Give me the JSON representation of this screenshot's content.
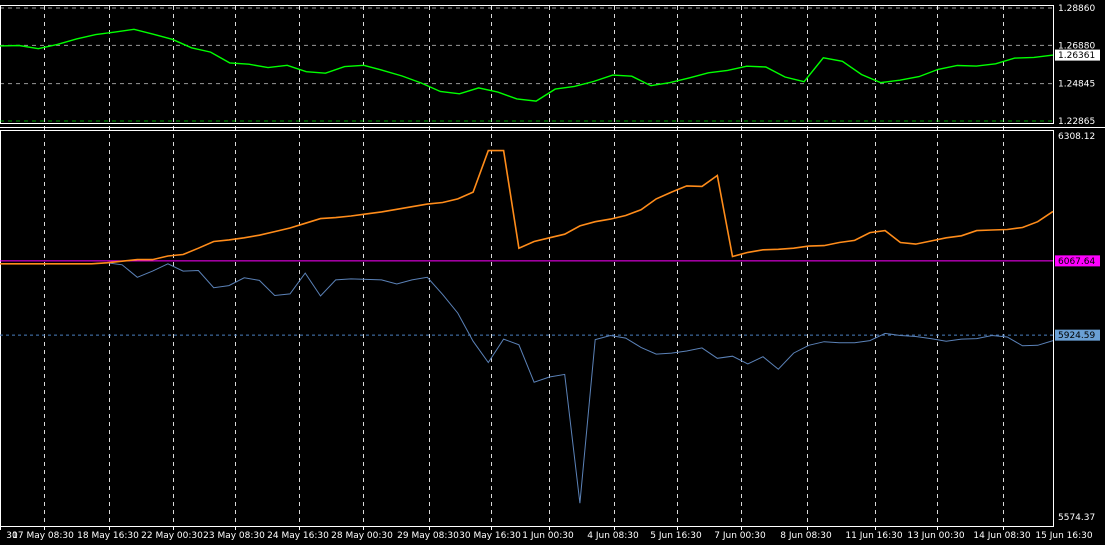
{
  "chart_data": [
    {
      "type": "line",
      "panel": "price",
      "ylim": [
        1.22865,
        1.2886
      ],
      "y_ticks": [
        "1.28860",
        "1.26880",
        "1.24845",
        "1.22865"
      ],
      "current_value_label": "1.26361",
      "colors": {
        "series": "#00ff00",
        "grid": "#ffffff",
        "label_bg": "#ffffff",
        "label_text": "#000000"
      },
      "series": [
        {
          "values": [
            1.2685,
            1.2687,
            1.267,
            1.2693,
            1.2722,
            1.2745,
            1.2758,
            1.2773,
            1.2747,
            1.272,
            1.2675,
            1.2652,
            1.2595,
            1.2588,
            1.257,
            1.2582,
            1.2548,
            1.254,
            1.2575,
            1.2582,
            1.2555,
            1.2525,
            1.2488,
            1.2443,
            1.2431,
            1.2462,
            1.244,
            1.2404,
            1.2392,
            1.2456,
            1.247,
            1.2496,
            1.253,
            1.2524,
            1.2474,
            1.249,
            1.2515,
            1.2542,
            1.2555,
            1.2577,
            1.2573,
            1.252,
            1.2495,
            1.2622,
            1.2603,
            1.2533,
            1.249,
            1.2503,
            1.2522,
            1.256,
            1.2581,
            1.2578,
            1.259,
            1.262,
            1.2624,
            1.2636
          ]
        }
      ]
    },
    {
      "type": "line",
      "panel": "balance",
      "ylim": [
        5574.37,
        6308.12
      ],
      "y_ticks": [
        "6308.12",
        "5574.37"
      ],
      "reference_lines": [
        {
          "value": 6067.64,
          "label": "6067.64",
          "style": "solid",
          "color": "#ff00ff",
          "label_bg": "#ff00ff",
          "label_text": "#000000"
        },
        {
          "value": 5924.59,
          "label": "5924.59",
          "style": "dashed",
          "color": "#4a7fbf",
          "label_bg": "#6a9fd4",
          "label_text": "#000000"
        }
      ],
      "colors": {
        "balance": "#ff8c1a",
        "equity": "#5b82b8",
        "grid": "#ffffff"
      },
      "series": [
        {
          "values": [
            6062,
            6062,
            6062,
            6062,
            6062,
            6062,
            6062,
            6064,
            6067,
            6070,
            6070,
            6077,
            6080,
            6092,
            6105,
            6108,
            6112,
            6117,
            6124,
            6131,
            6140,
            6149,
            6151,
            6154,
            6158,
            6162,
            6167,
            6172,
            6177,
            6180,
            6187,
            6200,
            6280,
            6280,
            6092,
            6105,
            6112,
            6119,
            6135,
            6143,
            6148,
            6155,
            6166,
            6187,
            6200,
            6212,
            6211,
            6232,
            6076,
            6084,
            6089,
            6090,
            6092,
            6096,
            6097,
            6103,
            6107,
            6122,
            6126,
            6103,
            6100,
            6106,
            6112,
            6116,
            6126,
            6127,
            6128,
            6132,
            6143,
            6163
          ]
        },
        {
          "values": [
            6062,
            6062,
            6062,
            6062,
            6062,
            6062,
            6062,
            6064,
            6060,
            6036,
            6048,
            6062,
            6048,
            6049,
            6016,
            6020,
            6035,
            6030,
            6001,
            6004,
            6044,
            6000,
            6031,
            6033,
            6032,
            6031,
            6023,
            6031,
            6036,
            6003,
            5967,
            5913,
            5872,
            5917,
            5906,
            5834,
            5844,
            5849,
            5601,
            5916,
            5924,
            5919,
            5901,
            5888,
            5890,
            5894,
            5900,
            5880,
            5884,
            5869,
            5883,
            5859,
            5890,
            5905,
            5912,
            5910,
            5910,
            5914,
            5928,
            5924,
            5922,
            5918,
            5913,
            5917,
            5918,
            5924,
            5921,
            5904,
            5905,
            5914
          ]
        }
      ]
    }
  ],
  "x_axis": {
    "ticks": [
      "30",
      "17 May 08:30",
      "18 May 16:30",
      "22 May 00:30",
      "23 May 08:30",
      "24 May 16:30",
      "28 May 00:30",
      "29 May 08:30",
      "30 May 16:30",
      "1 Jun 00:30",
      "4 Jun 08:30",
      "5 Jun 16:30",
      "7 Jun 00:30",
      "8 Jun 08:30",
      "11 Jun 16:30",
      "13 Jun 00:30",
      "14 Jun 08:30",
      "15 Jun 16:30"
    ]
  }
}
